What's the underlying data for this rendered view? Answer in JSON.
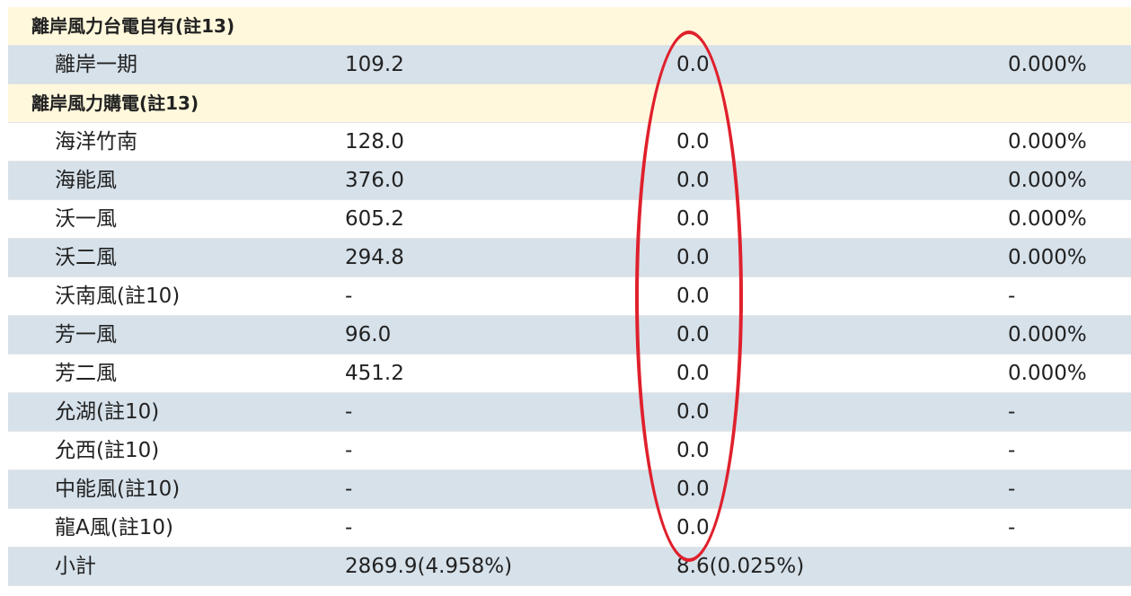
{
  "table": {
    "sections": [
      {
        "header": "離岸風力台電自有(註13)",
        "rows": [
          {
            "name": "離岸一期",
            "capacity": "109.2",
            "generation": "0.0",
            "percent": "0.000%"
          }
        ]
      },
      {
        "header": "離岸風力購電(註13)",
        "rows": [
          {
            "name": "海洋竹南",
            "capacity": "128.0",
            "generation": "0.0",
            "percent": "0.000%"
          },
          {
            "name": "海能風",
            "capacity": "376.0",
            "generation": "0.0",
            "percent": "0.000%"
          },
          {
            "name": "沃一風",
            "capacity": "605.2",
            "generation": "0.0",
            "percent": "0.000%"
          },
          {
            "name": "沃二風",
            "capacity": "294.8",
            "generation": "0.0",
            "percent": "0.000%"
          },
          {
            "name": "沃南風(註10)",
            "capacity": "-",
            "generation": "0.0",
            "percent": "-"
          },
          {
            "name": "芳一風",
            "capacity": "96.0",
            "generation": "0.0",
            "percent": "0.000%"
          },
          {
            "name": "芳二風",
            "capacity": "451.2",
            "generation": "0.0",
            "percent": "0.000%"
          },
          {
            "name": "允湖(註10)",
            "capacity": "-",
            "generation": "0.0",
            "percent": "-"
          },
          {
            "name": "允西(註10)",
            "capacity": "-",
            "generation": "0.0",
            "percent": "-"
          },
          {
            "name": "中能風(註10)",
            "capacity": "-",
            "generation": "0.0",
            "percent": "-"
          },
          {
            "name": "龍A風(註10)",
            "capacity": "-",
            "generation": "0.0",
            "percent": "-"
          }
        ]
      }
    ],
    "subtotal": {
      "name": "小計",
      "capacity": "2869.9(4.958%)",
      "generation": "8.6(0.025%)",
      "percent": ""
    }
  },
  "colors": {
    "header_bg": "#fff8dc",
    "row_blue": "#d6e1ea",
    "row_white": "#ffffff",
    "annotation": "#e0202c"
  }
}
